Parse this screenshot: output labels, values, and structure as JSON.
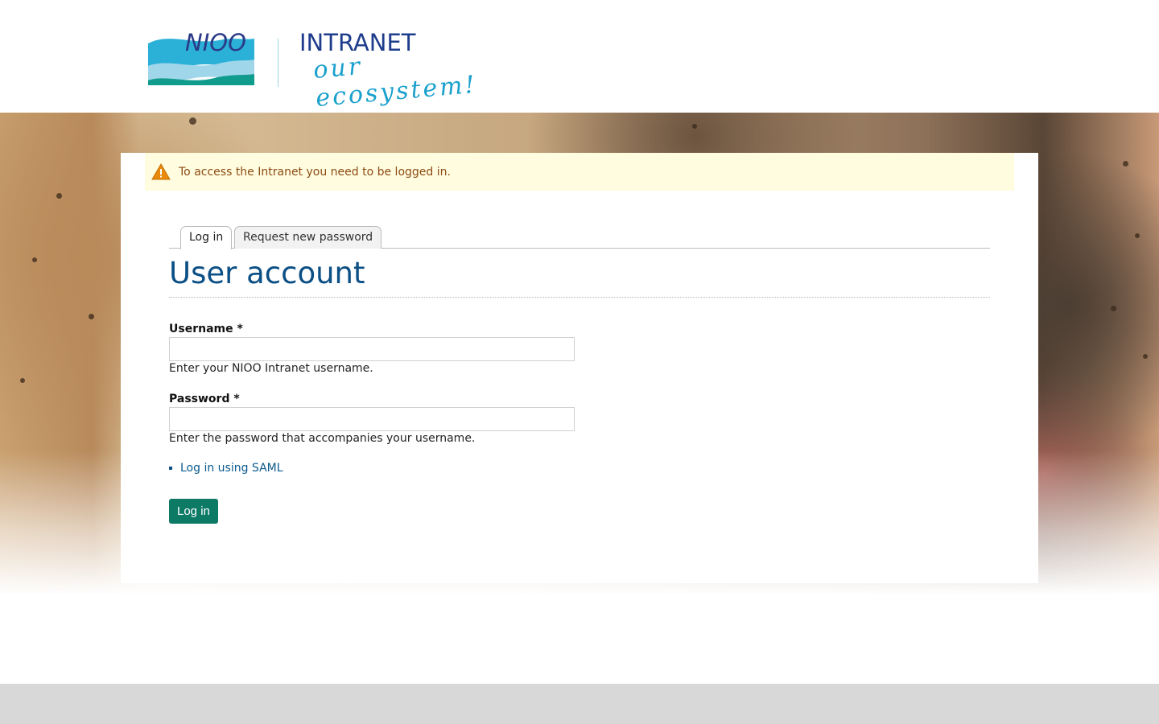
{
  "header": {
    "logo_nioo": "NIOO",
    "logo_intranet": "INTRANET",
    "logo_tagline": "our ecosystem!"
  },
  "message": {
    "icon": "warning-icon",
    "text": "To access the Intranet you need to be logged in."
  },
  "tabs": [
    {
      "label": "Log in",
      "active": true
    },
    {
      "label": "Request new password",
      "active": false
    }
  ],
  "page_title": "User account",
  "form": {
    "username": {
      "label": "Username *",
      "value": "",
      "description": "Enter your NIOO Intranet username."
    },
    "password": {
      "label": "Password *",
      "value": "",
      "description": "Enter the password that accompanies your username."
    },
    "saml_link": "Log in using SAML",
    "submit_label": "Log in"
  },
  "colors": {
    "accent_blue": "#0b4f85",
    "button_green": "#0d7a66",
    "warning_bg": "#fffce0",
    "warning_text": "#8c4b12"
  }
}
